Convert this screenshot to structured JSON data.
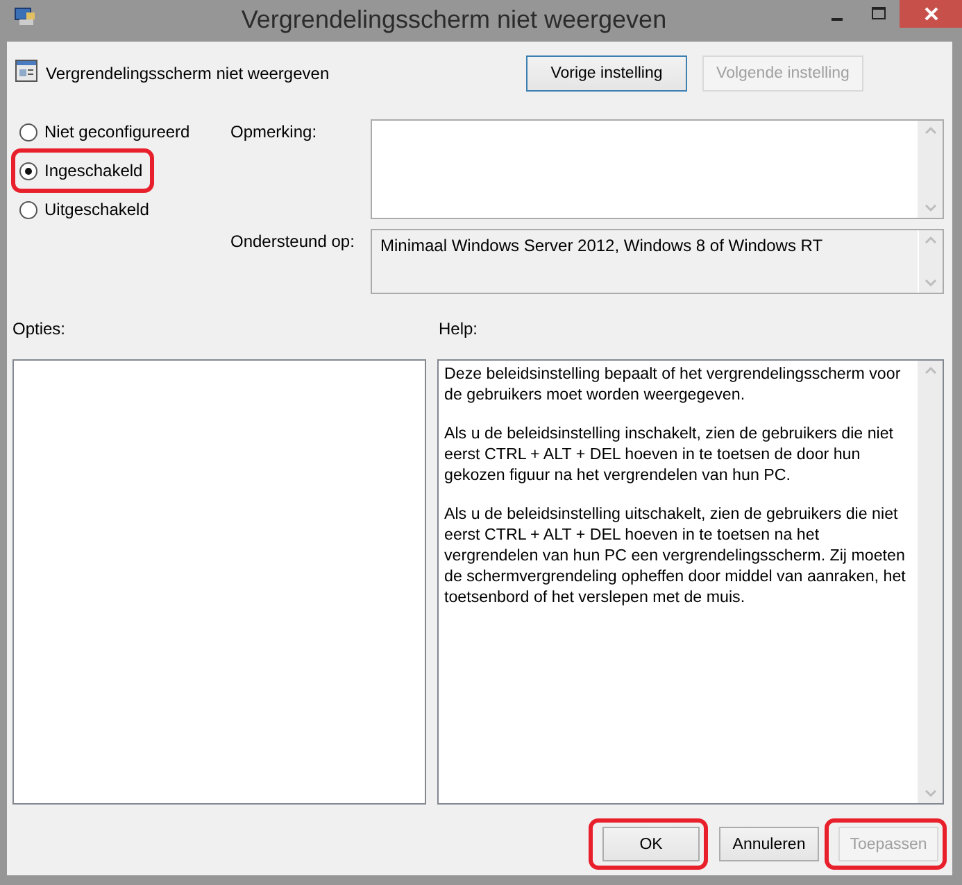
{
  "window": {
    "title": "Vergrendelingsscherm niet weergeven"
  },
  "policy": {
    "name": "Vergrendelingsscherm niet weergeven"
  },
  "nav_buttons": [
    {
      "label": "Vorige instelling",
      "disabled": false
    },
    {
      "label": "Volgende instelling",
      "disabled": true
    }
  ],
  "options": [
    {
      "label": "Niet geconfigureerd",
      "selected": false,
      "highlighted": false
    },
    {
      "label": "Ingeschakeld",
      "selected": true,
      "highlighted": true
    },
    {
      "label": "Uitgeschakeld",
      "selected": false,
      "highlighted": false
    }
  ],
  "comment": {
    "label": "Opmerking:"
  },
  "supported": {
    "label": "Ondersteund op:",
    "value": "Minimaal Windows Server 2012, Windows 8 of Windows RT"
  },
  "options_label": "Opties:",
  "help": {
    "label": "Help:",
    "paragraphs": [
      "Deze beleidsinstelling bepaalt of het vergrendelingsscherm voor de gebruikers moet worden weergegeven.",
      "Als u de beleidsinstelling inschakelt, zien de gebruikers die niet eerst CTRL + ALT + DEL hoeven in te toetsen de door hun gekozen figuur na het vergrendelen van hun PC.",
      "Als u de beleidsinstelling uitschakelt, zien de gebruikers die niet eerst CTRL + ALT + DEL hoeven in te toetsen na het vergrendelen van hun PC een vergrendelingsscherm. Zij moeten de schermvergrendeling opheffen door middel van aanraken, het toetsenbord of het verslepen met de muis."
    ]
  },
  "buttons": [
    {
      "label": "OK",
      "disabled": false,
      "highlighted": true
    },
    {
      "label": "Annuleren",
      "disabled": false,
      "highlighted": false
    },
    {
      "label": "Toepassen",
      "disabled": true,
      "highlighted": true
    }
  ]
}
